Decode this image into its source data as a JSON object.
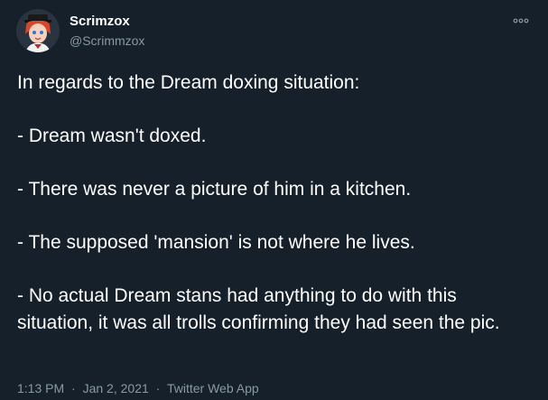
{
  "author": {
    "display_name": "Scrimzox",
    "handle": "@Scrimmzox",
    "avatar_icon": "profile-avatar-cartoon"
  },
  "more_icon": "more-options-icon",
  "tweet": {
    "lines": [
      "In regards to the Dream doxing situation:",
      "- Dream wasn't doxed.",
      "- There was never a picture of him in a kitchen.",
      "- The supposed 'mansion' is not where he lives.",
      "- No actual Dream stans had anything to do with this situation, it was all trolls confirming they had seen the pic."
    ]
  },
  "meta": {
    "time": "1:13 PM",
    "separator": "·",
    "date": "Jan 2, 2021",
    "source": "Twitter Web App"
  },
  "colors": {
    "background": "#15202b",
    "text": "#ffffff",
    "secondary_text": "#8899a6"
  }
}
